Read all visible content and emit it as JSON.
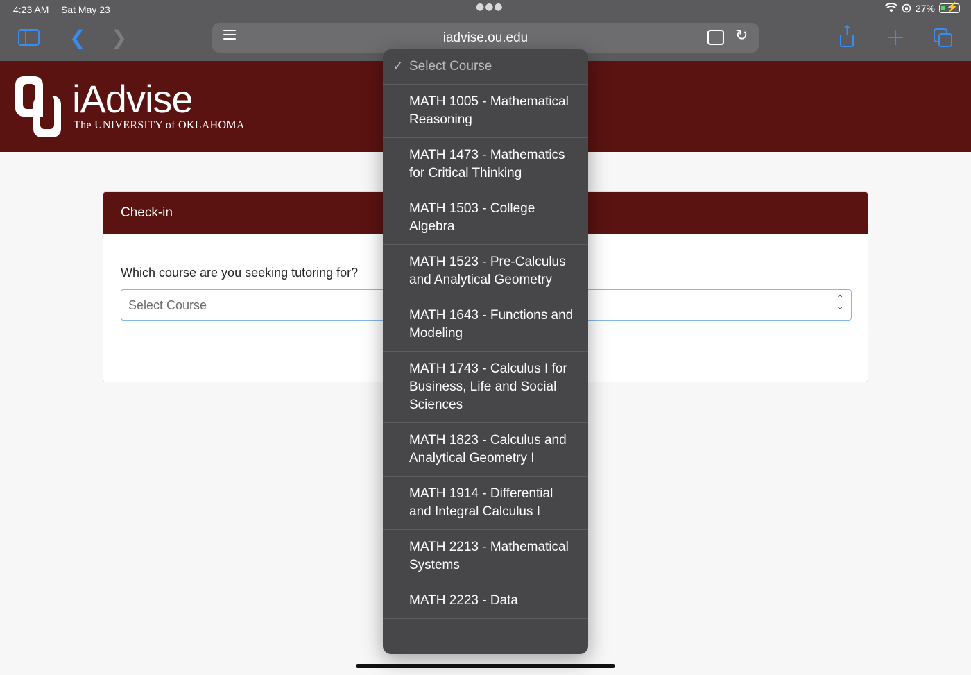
{
  "status_bar": {
    "time": "4:23 AM",
    "date": "Sat May 23",
    "battery": "27%"
  },
  "browser": {
    "url": "iadvise.ou.edu"
  },
  "brand": {
    "title": "iAdvise",
    "subtitle": "The UNIVERSITY of OKLAHOMA"
  },
  "card": {
    "header": "Check-in",
    "question": "Which course are you seeking tutoring for?",
    "select_value": "Select Course"
  },
  "dropdown": {
    "selected_label": "Select Course",
    "options": [
      "MATH 1005 - Mathematical Reasoning",
      "MATH 1473 - Mathematics for Critical Thinking",
      "MATH 1503 - College Algebra",
      "MATH 1523 - Pre-Calculus and Analytical Geometry",
      "MATH 1643 - Functions and Modeling",
      "MATH 1743 - Calculus I for Business, Life and Social Sciences",
      "MATH 1823 - Calculus and Analytical Geometry I",
      "MATH 1914 - Differential and Integral Calculus I",
      "MATH 2213 - Mathematical Systems",
      "MATH 2223 - Data"
    ]
  },
  "colors": {
    "brand_crimson": "#5a1311",
    "toolbar_gray": "#5b5b5e",
    "accent_blue": "#3a8df0"
  }
}
